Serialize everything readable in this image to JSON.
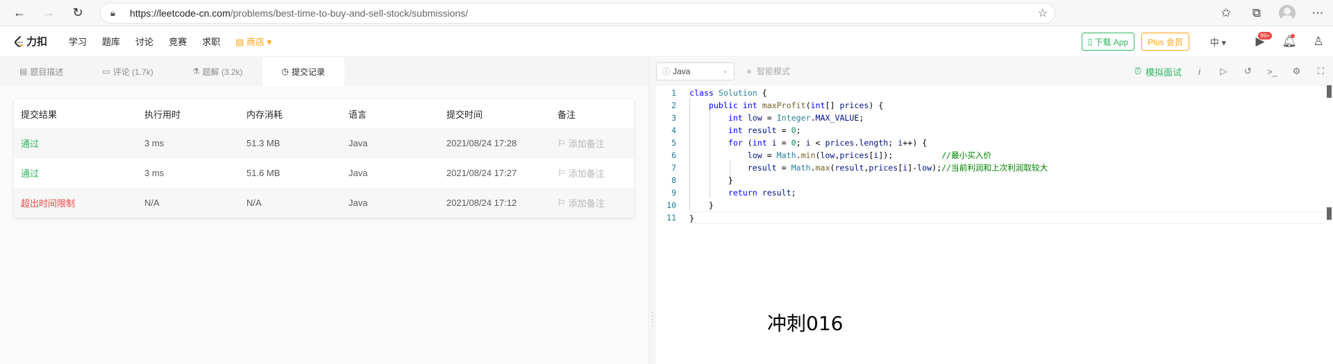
{
  "browser": {
    "url_host": "https://leetcode-cn.com",
    "url_path": "/problems/best-time-to-buy-and-sell-stock/submissions/"
  },
  "site": {
    "logo_text": "力扣",
    "nav": [
      "学习",
      "题库",
      "讨论",
      "竞赛",
      "求职"
    ],
    "shop_label": "商店",
    "download_app": "下载 App",
    "plus": "Plus 会员",
    "lang": "中",
    "badge": "99+"
  },
  "tabs": [
    {
      "label": "题目描述",
      "icon": "description-icon"
    },
    {
      "label": "评论 (1.7k)",
      "icon": "comment-icon"
    },
    {
      "label": "题解 (3.2k)",
      "icon": "flask-icon"
    },
    {
      "label": "提交记录",
      "icon": "clock-icon"
    }
  ],
  "table": {
    "headers": [
      "提交结果",
      "执行用时",
      "内存消耗",
      "语言",
      "提交时间",
      "备注"
    ],
    "rows": [
      {
        "result": "通过",
        "status": "pass",
        "time": "3 ms",
        "memory": "51.3 MB",
        "lang": "Java",
        "submitted": "2021/08/24 17:28",
        "note": "添加备注"
      },
      {
        "result": "通过",
        "status": "pass",
        "time": "3 ms",
        "memory": "51.6 MB",
        "lang": "Java",
        "submitted": "2021/08/24 17:27",
        "note": "添加备注"
      },
      {
        "result": "超出时间限制",
        "status": "fail",
        "time": "N/A",
        "memory": "N/A",
        "lang": "Java",
        "submitted": "2021/08/24 17:12",
        "note": "添加备注"
      }
    ]
  },
  "editor": {
    "language": "Java",
    "smart_mode": "智能模式",
    "mock_interview": "模拟面试",
    "line_numbers": [
      "1",
      "2",
      "3",
      "4",
      "5",
      "6",
      "7",
      "8",
      "9",
      "10",
      "11"
    ],
    "comment_1": "//最小买入价",
    "comment_2": "//当前利润和上次利润取较大"
  },
  "overlay_text": "冲刺016",
  "colors": {
    "pass": "#2db55d",
    "fail": "#ef4743",
    "shop": "#ffa116"
  }
}
